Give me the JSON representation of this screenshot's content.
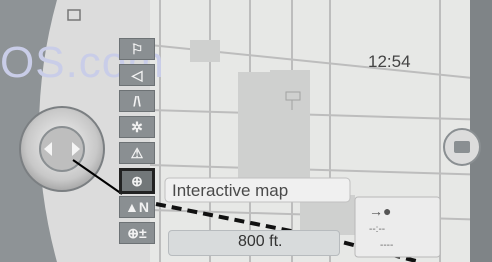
{
  "watermark": "OS.com",
  "clock": {
    "time": "12:54"
  },
  "toolbar": {
    "items": [
      {
        "name": "tool-poi-icon",
        "glyph": "⚐"
      },
      {
        "name": "tool-volume-icon",
        "glyph": "◁"
      },
      {
        "name": "tool-route-icon",
        "glyph": "/\\"
      },
      {
        "name": "tool-traffic-icon",
        "glyph": "✲"
      },
      {
        "name": "tool-warning-icon",
        "glyph": "⚠"
      },
      {
        "name": "tool-interactive-map-icon",
        "glyph": "⊕"
      },
      {
        "name": "tool-north-icon",
        "glyph": "▲N"
      },
      {
        "name": "tool-zoom-icon",
        "glyph": "⊕±"
      }
    ]
  },
  "map": {
    "interactive_label": "Interactive map",
    "scale": "800 ft."
  },
  "route_panel": {
    "dash1": "--:--",
    "dash2": "----"
  }
}
